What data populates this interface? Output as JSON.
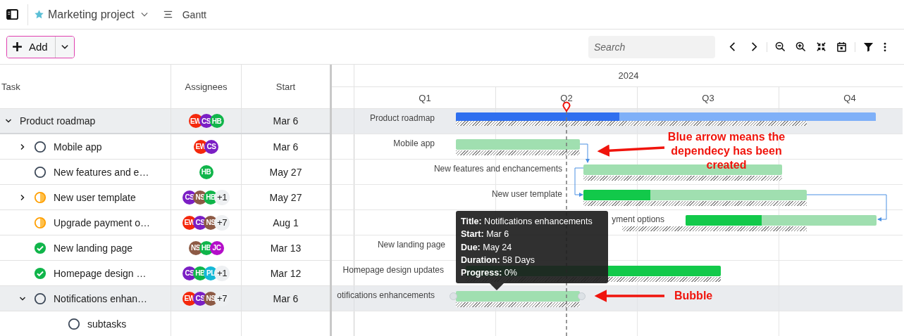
{
  "header": {
    "project": "Marketing project",
    "view": "Gantt"
  },
  "toolbar": {
    "add_button": "Add",
    "search": {
      "placeholder": "Search"
    }
  },
  "table": {
    "columns": [
      "Task",
      "Assignees",
      "Start"
    ],
    "rows": [
      {
        "task": "Product roadmap",
        "kind": "summary",
        "expanded": true,
        "selected": true,
        "assignees": [
          {
            "initials": "EW",
            "color": "#f4280c"
          },
          {
            "initials": "CS",
            "color": "#7b1fc4"
          },
          {
            "initials": "HB",
            "color": "#10b54a"
          }
        ],
        "start": "Mar 6",
        "children": [
          {
            "task": "Mobile app",
            "expanded": false,
            "selected": false,
            "kind": "todo",
            "assignees": [
              {
                "initials": "EW",
                "color": "#f4280c"
              },
              {
                "initials": "CS",
                "color": "#7b1fc4"
              }
            ],
            "start": "Mar 6"
          },
          {
            "task": "New features and e…",
            "selected": false,
            "kind": "todo",
            "assignees": [
              {
                "initials": "HB",
                "color": "#10b54a"
              }
            ],
            "start": "May 27"
          },
          {
            "task": "New user template",
            "expanded": false,
            "selected": false,
            "kind": "doing",
            "assignees": [
              {
                "initials": "CS",
                "color": "#7b1fc4"
              },
              {
                "initials": "NS",
                "color": "#8d5a45"
              },
              {
                "initials": "HB",
                "color": "#10b54a"
              }
            ],
            "more": "+1",
            "start": "May 27"
          },
          {
            "task": "Upgrade payment o…",
            "selected": false,
            "kind": "doing",
            "assignees": [
              {
                "initials": "EW",
                "color": "#f4280c"
              },
              {
                "initials": "CS",
                "color": "#7b1fc4"
              },
              {
                "initials": "NS",
                "color": "#8d5a45"
              }
            ],
            "more": "+7",
            "start": "Aug 1"
          },
          {
            "task": "New landing page",
            "selected": false,
            "kind": "done",
            "assignees": [
              {
                "initials": "NS",
                "color": "#8d5a45"
              },
              {
                "initials": "HB",
                "color": "#10b54a"
              },
              {
                "initials": "JC",
                "color": "#b40ec9"
              }
            ],
            "start": "Mar 13"
          },
          {
            "task": "Homepage design …",
            "selected": false,
            "kind": "done",
            "assignees": [
              {
                "initials": "CS",
                "color": "#7b1fc4"
              },
              {
                "initials": "HB",
                "color": "#10b54a"
              },
              {
                "initials": "PL",
                "color": "#14b8d6"
              }
            ],
            "more": "+1",
            "start": "Mar 12"
          },
          {
            "task": "Notifications enhan…",
            "expanded": true,
            "selected": true,
            "kind": "todo",
            "assignees": [
              {
                "initials": "EW",
                "color": "#f4280c"
              },
              {
                "initials": "CS",
                "color": "#7b1fc4"
              },
              {
                "initials": "NS",
                "color": "#8d5a45"
              }
            ],
            "more": "+7",
            "start": "Mar 6",
            "children": [
              {
                "task": "subtasks",
                "selected": false,
                "kind": "todo"
              }
            ]
          }
        ]
      }
    ]
  },
  "gantt": {
    "year": "2024",
    "quarters": [
      "Q1",
      "Q2",
      "Q3",
      "Q4"
    ],
    "rows": [
      {
        "label": "Product roadmap",
        "kind": "summary",
        "level": 0.39,
        "handles": false
      },
      {
        "label": "Mobile app",
        "kind": "task",
        "handles": false
      },
      {
        "label": "New features and enchancements",
        "kind": "task",
        "handles": false
      },
      {
        "label": "New user template",
        "kind": "task",
        "level": 0.3,
        "handles": false
      },
      {
        "label": "yment options",
        "kind": "task",
        "level": 0.4,
        "handles": false
      },
      {
        "label": "New landing page"
      },
      {
        "label": "Homepage design updates",
        "kind": "task",
        "level": 1,
        "handles": false
      },
      {
        "label": "otifications enhancements",
        "kind": "task",
        "handles": true
      }
    ],
    "tooltip": [
      "**Title:** Notifications enhancements",
      "**Start:** Mar 6",
      "**Due:** May 24",
      "**Duration:** 58 Days",
      "**Progress:** 0%"
    ]
  },
  "annotations": [
    "Blue arrow means the dependecy has been created",
    "Bubble"
  ]
}
